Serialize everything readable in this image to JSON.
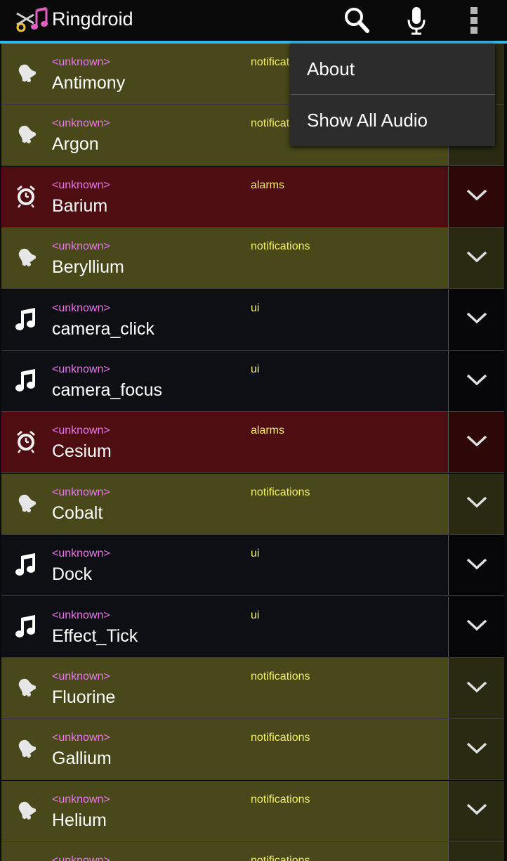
{
  "app": {
    "title": "Ringdroid",
    "accent": "#33b5e5"
  },
  "actionbar": {
    "search_icon": "search-icon",
    "mic_icon": "microphone-icon",
    "overflow_icon": "overflow-menu-icon"
  },
  "menu": {
    "items": [
      {
        "label": "About"
      },
      {
        "label": "Show All Audio"
      }
    ]
  },
  "rows": [
    {
      "artist": "<unknown>",
      "title": "Antimony",
      "category": "notifications",
      "type": "notif",
      "icon": "notification-bell-icon"
    },
    {
      "artist": "<unknown>",
      "title": "Argon",
      "category": "notifications",
      "type": "notif",
      "icon": "notification-bell-icon"
    },
    {
      "artist": "<unknown>",
      "title": "Barium",
      "category": "alarms",
      "type": "alarm",
      "icon": "alarm-clock-icon"
    },
    {
      "artist": "<unknown>",
      "title": "Beryllium",
      "category": "notifications",
      "type": "notif",
      "icon": "notification-bell-icon"
    },
    {
      "artist": "<unknown>",
      "title": "camera_click",
      "category": "ui",
      "type": "ui",
      "icon": "music-note-icon"
    },
    {
      "artist": "<unknown>",
      "title": "camera_focus",
      "category": "ui",
      "type": "ui",
      "icon": "music-note-icon"
    },
    {
      "artist": "<unknown>",
      "title": "Cesium",
      "category": "alarms",
      "type": "alarm",
      "icon": "alarm-clock-icon"
    },
    {
      "artist": "<unknown>",
      "title": "Cobalt",
      "category": "notifications",
      "type": "notif",
      "icon": "notification-bell-icon"
    },
    {
      "artist": "<unknown>",
      "title": "Dock",
      "category": "ui",
      "type": "ui",
      "icon": "music-note-icon"
    },
    {
      "artist": "<unknown>",
      "title": "Effect_Tick",
      "category": "ui",
      "type": "ui",
      "icon": "music-note-icon"
    },
    {
      "artist": "<unknown>",
      "title": "Fluorine",
      "category": "notifications",
      "type": "notif",
      "icon": "notification-bell-icon"
    },
    {
      "artist": "<unknown>",
      "title": "Gallium",
      "category": "notifications",
      "type": "notif",
      "icon": "notification-bell-icon"
    },
    {
      "artist": "<unknown>",
      "title": "Helium",
      "category": "notifications",
      "type": "notif",
      "icon": "notification-bell-icon"
    },
    {
      "artist": "<unknown>",
      "title": "",
      "category": "notifications",
      "type": "notif",
      "icon": "notification-bell-icon"
    }
  ]
}
